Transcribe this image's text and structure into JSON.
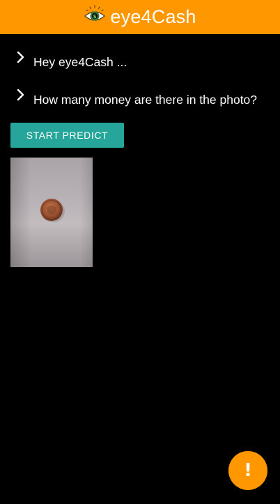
{
  "app_bar": {
    "title": "eye4Cash",
    "logo_icon": "eye-with-dollar-icon",
    "background_color": "#ff9800"
  },
  "messages": [
    {
      "icon": "chevron-right-icon",
      "text": "Hey eye4Cash ..."
    },
    {
      "icon": "chevron-right-icon",
      "text": "How many money are there in the photo?"
    }
  ],
  "predict_button": {
    "label": "START PREDICT",
    "color": "#26a69a"
  },
  "photo": {
    "description_icon": "coin-photo",
    "content": "copper coin on grey surface"
  },
  "fab": {
    "icon": "exclamation-icon",
    "glyph": "!",
    "color": "#ff9800"
  }
}
